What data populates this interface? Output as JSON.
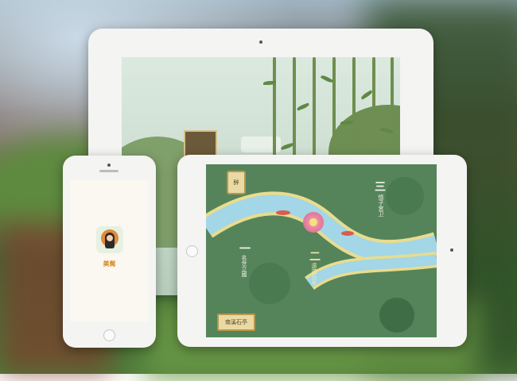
{
  "phone": {
    "app_name": "美髯"
  },
  "ipad_mini": {
    "badge": "醉",
    "sign_text": "南溪石亭",
    "stage1": {
      "num": "一",
      "label": "名世立國"
    },
    "stage2": {
      "num": "二",
      "label": "遠遊兵家"
    },
    "stage3": {
      "num": "三",
      "label": "憶子宮卫"
    }
  },
  "colors": {
    "device_frame": "#f4f4f2",
    "game_green": "#55845b",
    "river_blue": "#9fd5e8",
    "accent_gold": "#d48a2a"
  }
}
